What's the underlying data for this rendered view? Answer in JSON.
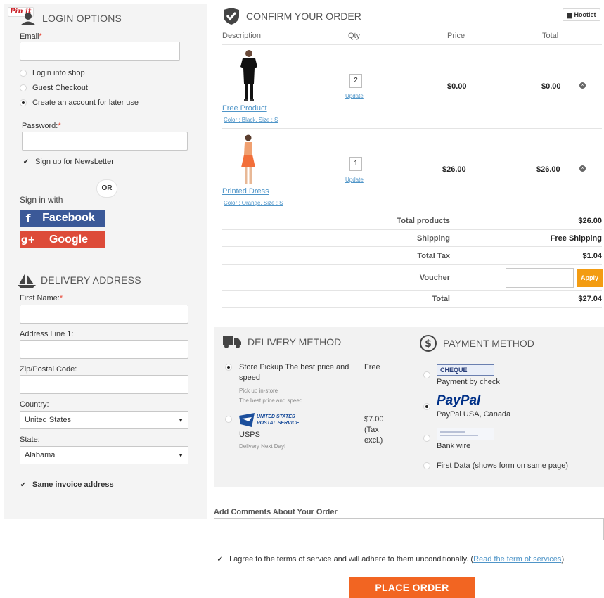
{
  "login": {
    "pinit_label": "Pin it",
    "title": "LOGIN OPTIONS",
    "email_label": "Email",
    "required_mark": "*",
    "options": [
      "Login into shop",
      "Guest Checkout",
      "Create an account for later use"
    ],
    "selected_option": 2,
    "password_label": "Password:",
    "newsletter_label": "Sign up for NewsLetter",
    "or_label": "OR",
    "sign_in_with": "Sign in with",
    "facebook_label": "Facebook",
    "facebook_icon": "f",
    "google_label": "Google",
    "google_icon": "g+",
    "colors": {
      "facebook": "#3b5998",
      "google": "#dd4b39"
    }
  },
  "delivery_address": {
    "title": "DELIVERY ADDRESS",
    "first_name_label": "First Name:",
    "address_label": "Address Line 1:",
    "zip_label": "Zip/Postal Code:",
    "country_label": "Country:",
    "country_value": "United States",
    "state_label": "State:",
    "state_value": "Alabama",
    "same_invoice_label": "Same invoice address"
  },
  "order": {
    "title": "CONFIRM YOUR ORDER",
    "hootlet_label": "Hootlet",
    "columns": {
      "description": "Description",
      "qty": "Qty",
      "price": "Price",
      "total": "Total"
    },
    "items": [
      {
        "name": "Free Product",
        "attributes": "Color : Black, Size : S",
        "qty": "2",
        "update_label": "Update",
        "price": "$0.00",
        "total": "$0.00",
        "remove_icon": "×"
      },
      {
        "name": "Printed Dress",
        "attributes": "Color : Orange, Size : S",
        "qty": "1",
        "update_label": "Update",
        "price": "$26.00",
        "total": "$26.00",
        "remove_icon": "×"
      }
    ],
    "summary": {
      "total_products_label": "Total products",
      "total_products": "$26.00",
      "shipping_label": "Shipping",
      "shipping": "Free Shipping",
      "tax_label": "Total Tax",
      "tax": "$1.04",
      "voucher_label": "Voucher",
      "apply_label": "Apply",
      "total_label": "Total",
      "total": "$27.04"
    }
  },
  "delivery_method": {
    "title": "DELIVERY METHOD",
    "options": [
      {
        "name": "Store Pickup The best price and speed",
        "sub1": "Pick up in-store",
        "sub2": "The best price and speed",
        "price": "Free"
      },
      {
        "name": "USPS",
        "logo_line1": "UNITED STATES",
        "logo_line2": "POSTAL SERVICE",
        "sub1": "Delivery Next Day!",
        "price": "$7.00 (Tax excl.)"
      }
    ],
    "selected_option": 0
  },
  "payment_method": {
    "title": "PAYMENT METHOD",
    "cheque_logo": "CHEQUE",
    "cheque_label": "Payment by check",
    "paypal_logo": "PayPal",
    "paypal_label": "PayPal USA, Canada",
    "bankwire_label": "Bank wire",
    "firstdata_label": "First Data (shows form on same page)",
    "selected_option": 1
  },
  "comments": {
    "label": "Add Comments About Your Order"
  },
  "terms": {
    "text": "I agree to the terms of service and will adhere to them unconditionally. (",
    "link_text": "Read the term of services",
    "closing": ")"
  },
  "place_order_label": "PLACE ORDER",
  "accent_color": "#f26522"
}
